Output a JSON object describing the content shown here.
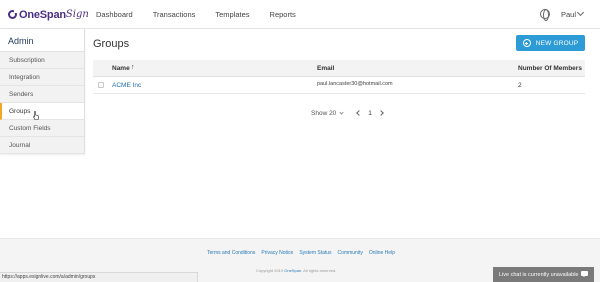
{
  "header": {
    "logo_text": "OneSpan",
    "logo_sign": "Sign",
    "nav": [
      "Dashboard",
      "Transactions",
      "Templates",
      "Reports"
    ],
    "user": "Paul",
    "globe_icon": "globe-icon"
  },
  "sidebar": {
    "title": "Admin",
    "items": [
      {
        "label": "Subscription",
        "active": false
      },
      {
        "label": "Integration",
        "active": false
      },
      {
        "label": "Senders",
        "active": false
      },
      {
        "label": "Groups",
        "active": true
      },
      {
        "label": "Custom Fields",
        "active": false
      },
      {
        "label": "Journal",
        "active": false
      }
    ],
    "active_color": "#f5a623"
  },
  "main": {
    "title": "Groups",
    "new_group_label": "NEW GROUP",
    "accent": "#2d9bd5",
    "table": {
      "columns": [
        "Name",
        "Email",
        "Number Of Members"
      ],
      "sort_indicator": "↑",
      "rows": [
        {
          "name": "ACME Inc",
          "email": "paul.lancaster30@hotmail.com",
          "members": "2"
        }
      ]
    },
    "pager": {
      "show_label": "Show 20",
      "page": "1"
    }
  },
  "footer": {
    "links": [
      "Terms and Conditions",
      "Privacy Notice",
      "System Status",
      "Community",
      "Online Help"
    ],
    "copyright_prefix": "Copyright 2019",
    "copyright_brand": "OneSpan",
    "copyright_suffix": ". All rights reserved."
  },
  "status_bar": {
    "url": "https://apps.esignlive.com/a/admin/groups"
  },
  "chat": {
    "label": "Live chat is currently unavailable"
  }
}
